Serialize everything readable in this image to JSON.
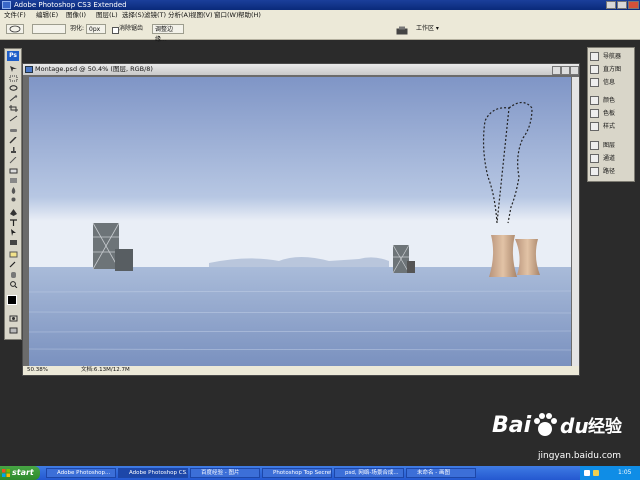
{
  "titlebar": {
    "title": "Adobe Photoshop CS3 Extended"
  },
  "menubar": {
    "items": [
      "文件(F)",
      "编辑(E)",
      "图像(I)",
      "图层(L)",
      "选择(S)",
      "滤镜(T)",
      "分析(A)",
      "视图(V)",
      "窗口(W)",
      "帮助(H)"
    ]
  },
  "options": {
    "feather_label": "羽化:",
    "feather_value": "0px",
    "antialias_label": "消除锯齿",
    "refine_edge": "调整边缘...",
    "workspace": "工作区 ▾"
  },
  "toolbox": {
    "logo": "Ps"
  },
  "document": {
    "title": "Montage.psd @ 50.4% (图层, RGB/8)",
    "status_zoom": "50.38%",
    "status_doc": "文档:6.13M/12.7M"
  },
  "panels": {
    "items": [
      "导航器",
      "直方图",
      "信息",
      "颜色",
      "色板",
      "样式",
      "图层",
      "通道",
      "路径"
    ]
  },
  "taskbar": {
    "start": "start",
    "buttons": [
      "Adobe Photoshop...",
      "Adobe Photoshop CS...",
      "百度经验 - 图片",
      "Photoshop Top Secret...",
      "psd, 网络-场景合成...",
      "未命名 - 画图"
    ],
    "clock": "1:05"
  },
  "watermark": {
    "brand": "Bai",
    "brand2": "du",
    "jingyan": "经验",
    "url": "jingyan.baidu.com"
  },
  "colors": {
    "titlebar": "#0a2a7a",
    "sky_top": "#7f95c6",
    "sea": "#8aa2c9",
    "tower": "#d4b094"
  }
}
